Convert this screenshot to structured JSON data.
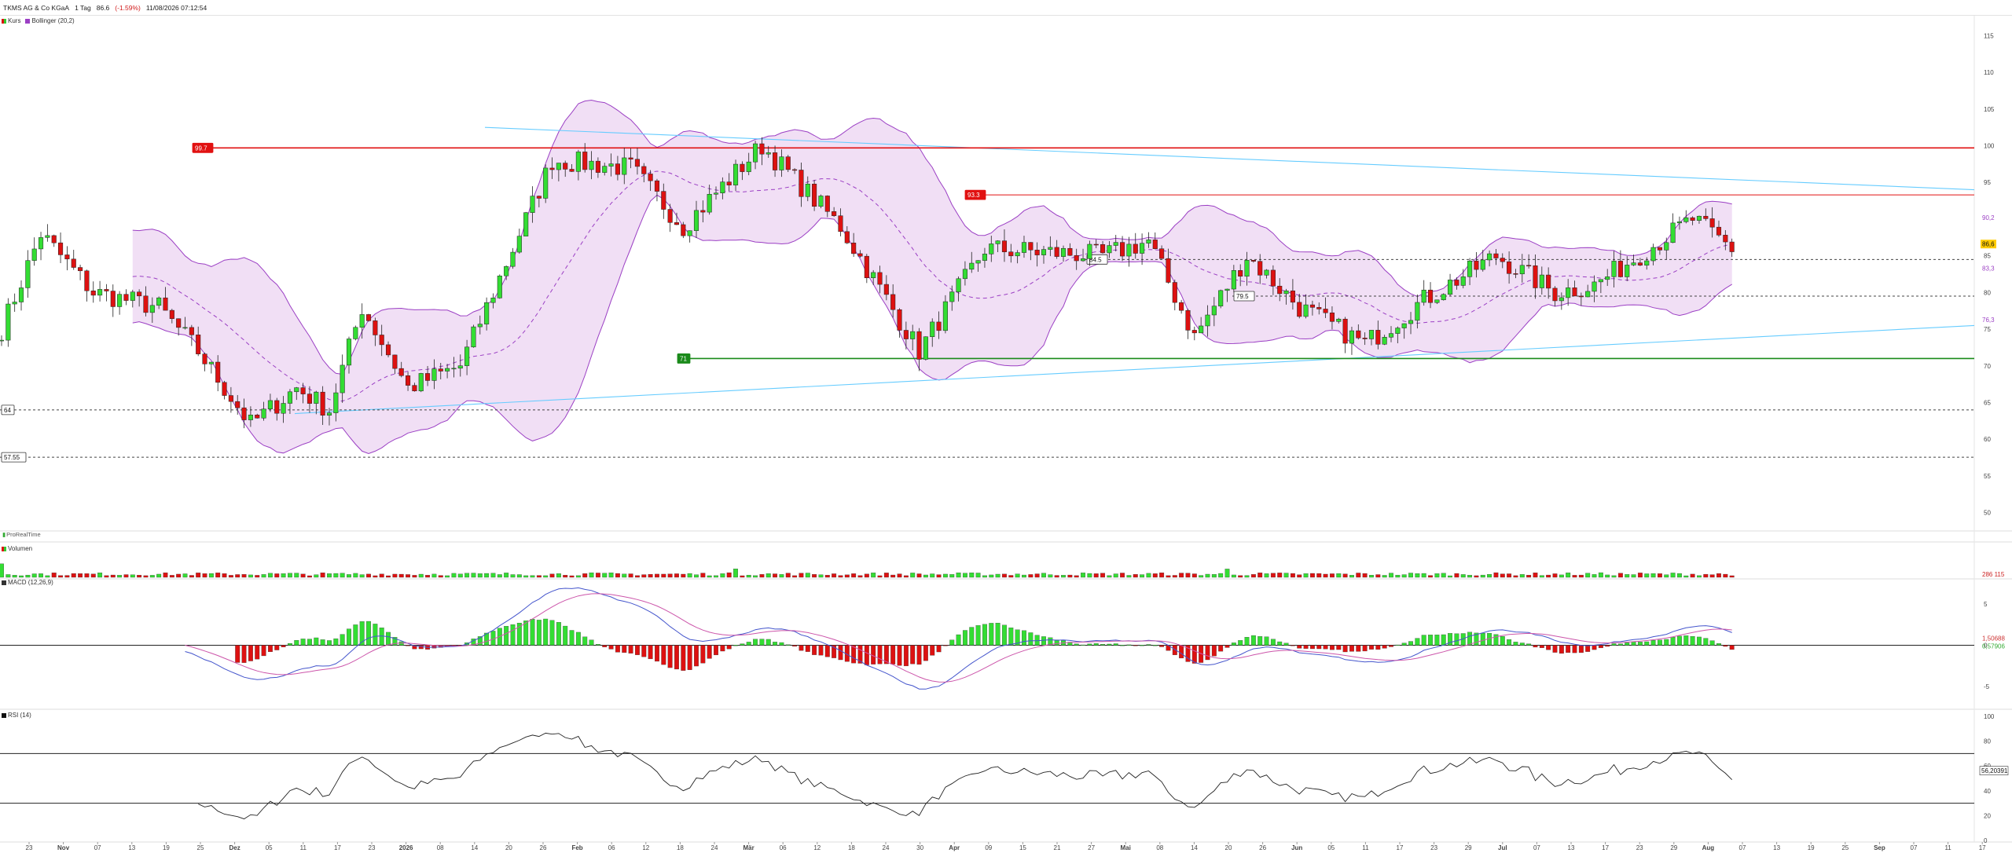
{
  "header": {
    "name": "TKMS AG & Co KGaA",
    "period": "1 Tag",
    "last": "86.6",
    "change": "(-1.59%)",
    "datetime": "11/08/2026 07:12:54"
  },
  "legends": {
    "price": [
      {
        "label": "Kurs",
        "color": "#33cc33"
      },
      {
        "label": "Bollinger (20,2)",
        "color": "#9b3fc4"
      }
    ],
    "volume": {
      "label": "Volumen",
      "color": "#33cc33"
    },
    "macd": {
      "label": "MACD (12,26,9)",
      "color": "#333333"
    },
    "rsi": {
      "label": "RSI (14)",
      "color": "#111111"
    }
  },
  "brand": "ProRealTime",
  "colors": {
    "up": "#33dd33",
    "down": "#dd1111",
    "bollinger": "#9b3fc4",
    "bollinger_fill": "#f1dff5",
    "trend": "#66ccff",
    "support": "#1a8a1a",
    "resist": "#e11111"
  },
  "chart_data": [
    {
      "type": "candlestick",
      "panel": "price",
      "y_ticks": [
        50,
        55,
        60,
        65,
        70,
        75,
        80,
        85,
        90,
        95,
        100,
        105,
        110,
        115
      ],
      "ylim": [
        47.5,
        117.5
      ],
      "x_ticks": [
        "23",
        "Nov",
        "07",
        "13",
        "19",
        "25",
        "Dez",
        "05",
        "11",
        "17",
        "23",
        "2026",
        "08",
        "14",
        "20",
        "26",
        "Feb",
        "06",
        "12",
        "18",
        "24",
        "Mär",
        "06",
        "12",
        "18",
        "24",
        "30",
        "Apr",
        "09",
        "15",
        "21",
        "27",
        "Mai",
        "08",
        "14",
        "20",
        "26",
        "Jun",
        "05",
        "11",
        "17",
        "23",
        "29",
        "Jul",
        "07",
        "13",
        "17",
        "23",
        "29",
        "Aug",
        "07",
        "13",
        "19",
        "25",
        "Sep",
        "07",
        "11",
        "17"
      ],
      "horizontal_levels": [
        {
          "value": 99.7,
          "label": "99.7",
          "style": "resistance"
        },
        {
          "value": 93.3,
          "label": "93.3",
          "style": "resistance"
        },
        {
          "value": 71,
          "label": "71",
          "style": "support"
        },
        {
          "value": 84.5,
          "label": "84.5",
          "style": "dotted"
        },
        {
          "value": 79.5,
          "label": "79.5",
          "style": "dotted"
        },
        {
          "value": 64,
          "label": "64",
          "style": "dotted"
        },
        {
          "value": 57.55,
          "label": "57.55",
          "style": "dotted"
        }
      ],
      "right_badges": [
        {
          "value": 90.2,
          "label": "90,2",
          "kind": "bb-upper"
        },
        {
          "value": 86.6,
          "label": "86,6",
          "kind": "last"
        },
        {
          "value": 83.3,
          "label": "83,3",
          "kind": "bb-mid"
        },
        {
          "value": 76.3,
          "label": "76,3",
          "kind": "bb-lower"
        }
      ],
      "series": [
        {
          "name": "Kurs",
          "type": "candlestick"
        },
        {
          "name": "Bollinger (20,2)",
          "type": "band"
        }
      ]
    },
    {
      "type": "bar",
      "panel": "volume",
      "right_label": "286 115"
    },
    {
      "type": "line",
      "panel": "macd",
      "y_ticks": [
        -5,
        0,
        5
      ],
      "ylim": [
        -7.5,
        7.5
      ],
      "right_values": [
        {
          "label": "1,50688",
          "color": "#cc3333"
        },
        {
          "label": "0,57906",
          "color": "#33aa33"
        }
      ]
    },
    {
      "type": "line",
      "panel": "rsi",
      "y_ticks": [
        0,
        20,
        40,
        60,
        80,
        100
      ],
      "ylim": [
        0,
        100
      ],
      "levels": [
        70,
        30
      ],
      "last_label": "56,20391"
    }
  ]
}
